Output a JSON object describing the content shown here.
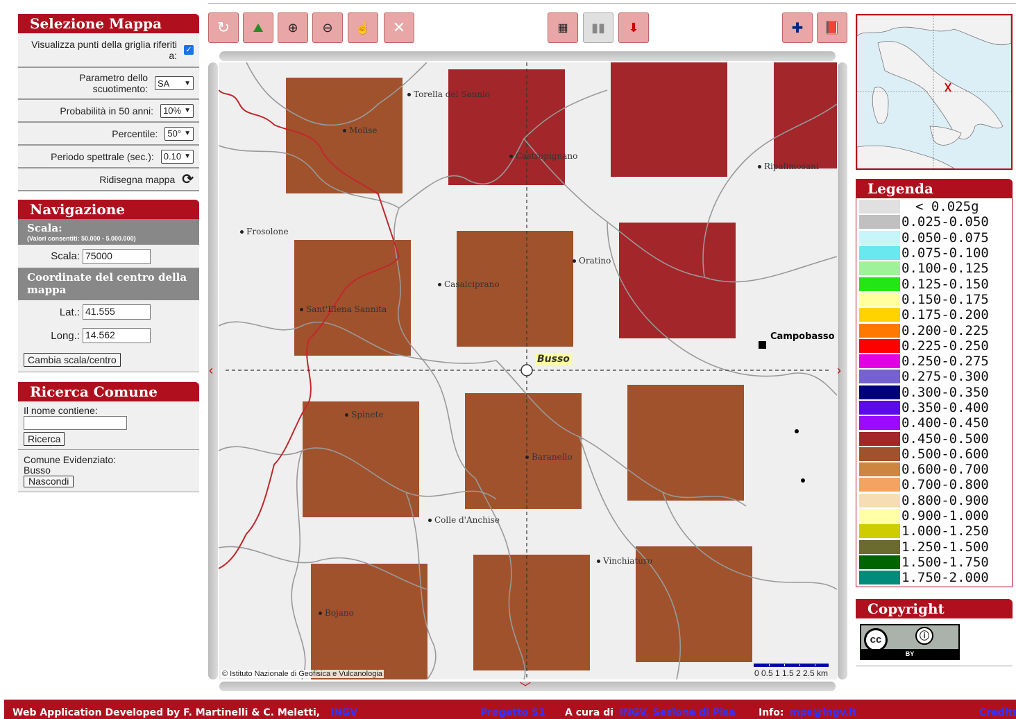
{
  "left": {
    "selezione": {
      "title": "Selezione Mappa",
      "grid_label": "Visualizza punti della griglia riferiti a:",
      "param_label": "Parametro dello scuotimento:",
      "param_value": "SA",
      "prob_label": "Probabilità in 50 anni:",
      "prob_value": "10%",
      "perc_label": "Percentile:",
      "perc_value": "50°",
      "period_label": "Periodo spettrale (sec.):",
      "period_value": "0.10",
      "redraw_label": "Ridisegna mappa"
    },
    "navigazione": {
      "title": "Navigazione",
      "scala_head": "Scala:",
      "scala_note": "(Valori consentiti: 50.000 - 5.000.000)",
      "scala_label": "Scala:",
      "scala_value": "75000",
      "coord_head": "Coordinate del centro della mappa",
      "lat_label": "Lat.:",
      "lat_value": "41.555",
      "long_label": "Long.:",
      "long_value": "14.562",
      "button": "Cambia scala/centro"
    },
    "ricerca": {
      "title": "Ricerca Comune",
      "name_label": "Il nome contiene:",
      "search_button": "Ricerca",
      "highlight_label": "Comune Evidenziato:",
      "highlight_value": "Busso",
      "hide_button": "Nascondi"
    }
  },
  "map": {
    "towns": [
      "Torella del Sannio",
      "Molise",
      "Castropignano",
      "Ripalimosani",
      "Frosolone",
      "Oratino",
      "Casalciprano",
      "Sant'Elena Sannita",
      "Campobasso",
      "Busso",
      "Spinete",
      "Baranello",
      "Colle d'Anchise",
      "Vinchiaturo",
      "Bojano"
    ],
    "attribution": "© Istituto Nazionale di Geofisica e Vulcanologia",
    "scale_label": "0 0.5 1 1.5 2 2.5 km"
  },
  "legend": {
    "title": "Legenda",
    "items": [
      {
        "label": "< 0.025g",
        "color": "#e0e0e0"
      },
      {
        "label": "0.025-0.050",
        "color": "#c0c0c0"
      },
      {
        "label": "0.050-0.075",
        "color": "#c6f6f9"
      },
      {
        "label": "0.075-0.100",
        "color": "#69e8f0"
      },
      {
        "label": "0.100-0.125",
        "color": "#9ff29a"
      },
      {
        "label": "0.125-0.150",
        "color": "#22e615"
      },
      {
        "label": "0.150-0.175",
        "color": "#ffff9e"
      },
      {
        "label": "0.175-0.200",
        "color": "#ffd200"
      },
      {
        "label": "0.200-0.225",
        "color": "#ff7800"
      },
      {
        "label": "0.225-0.250",
        "color": "#ff0000"
      },
      {
        "label": "0.250-0.275",
        "color": "#e100e1"
      },
      {
        "label": "0.275-0.300",
        "color": "#7561cf"
      },
      {
        "label": "0.300-0.350",
        "color": "#00007d"
      },
      {
        "label": "0.350-0.400",
        "color": "#5a0aeb"
      },
      {
        "label": "0.400-0.450",
        "color": "#9c0aff"
      },
      {
        "label": "0.450-0.500",
        "color": "#a3262a"
      },
      {
        "label": "0.500-0.600",
        "color": "#a0522d"
      },
      {
        "label": "0.600-0.700",
        "color": "#cd853f"
      },
      {
        "label": "0.700-0.800",
        "color": "#f4a460"
      },
      {
        "label": "0.800-0.900",
        "color": "#f5deb3"
      },
      {
        "label": "0.900-1.000",
        "color": "#ffffa5"
      },
      {
        "label": "1.000-1.250",
        "color": "#cdcd00"
      },
      {
        "label": "1.250-1.500",
        "color": "#6b6b30"
      },
      {
        "label": "1.500-1.750",
        "color": "#006400"
      },
      {
        "label": "1.750-2.000",
        "color": "#008b7b"
      }
    ]
  },
  "copyright": {
    "title": "Copyright",
    "badge_text": "BY",
    "cc_text": "cc"
  },
  "footer": {
    "developed": "Web Application Developed by F. Martinelli & C. Meletti,",
    "ingv": "INGV",
    "progetto": "Progetto S1",
    "acura": "A cura di",
    "acura_link": "INGV, Sezione di Pisa",
    "info": "Info:",
    "email": "mps@ingv.it",
    "credits": "Credits"
  },
  "colors": {
    "brand": "#b0101e",
    "cell_high": "#a3262a",
    "cell_mid": "#a0522d"
  }
}
